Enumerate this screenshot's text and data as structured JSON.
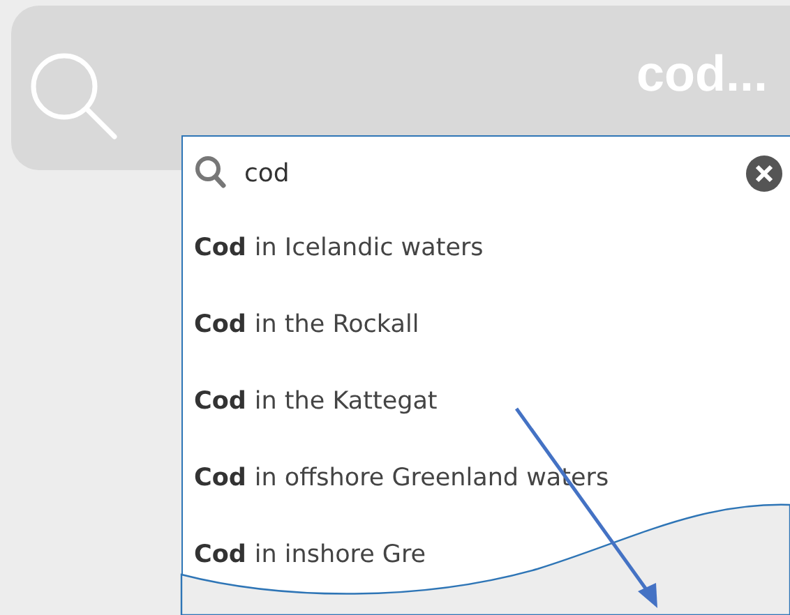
{
  "search_bar": {
    "text": "cod..."
  },
  "dropdown": {
    "query": "cod",
    "results": [
      "**Cod** in Icelandic waters",
      "**Cod** in the Rockall",
      "**Cod** in the Kattegat",
      "**Cod** in offshore Greenland waters",
      "**Cod** in inshore Gre"
    ]
  }
}
